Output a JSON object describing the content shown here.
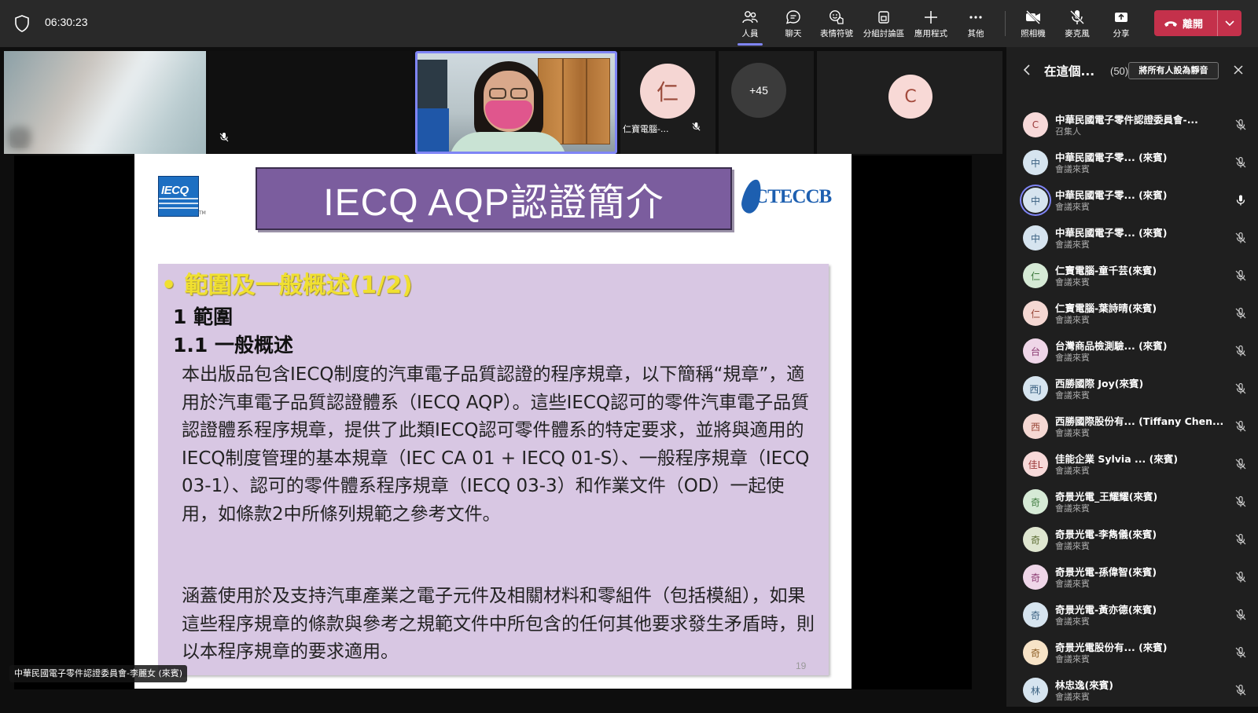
{
  "call": {
    "timer": "06:30:23",
    "toolbar": [
      {
        "label": "人員",
        "icon": "people-icon",
        "active": true
      },
      {
        "label": "聊天",
        "icon": "chat-icon"
      },
      {
        "label": "表情符號",
        "icon": "reactions-icon"
      },
      {
        "label": "分組討論區",
        "icon": "breakout-rooms-icon"
      },
      {
        "label": "應用程式",
        "icon": "add-apps-icon"
      },
      {
        "label": "其他",
        "icon": "more-icon"
      },
      {
        "label": "照相機",
        "icon": "camera-off-icon"
      },
      {
        "label": "麥克風",
        "icon": "mic-off-icon"
      },
      {
        "label": "分享",
        "icon": "share-icon"
      }
    ],
    "leave_label": "離開"
  },
  "video_strip": {
    "tile4_initial": "仁",
    "tile4_name": "仁寶電腦-...",
    "overflow_count": "+45",
    "tile6_initial": "C"
  },
  "slide": {
    "title": "IECQ AQP認證簡介",
    "left_logo": "IECQ",
    "right_logo": "CTECCB",
    "bullet": "•  範圍及一般概述(1/2)",
    "section_1": "1 範圍",
    "section_1_1": "1.1 一般概述",
    "paragraph_1": "本出版品包含IECQ制度的汽車電子品質認證的程序規章，以下簡稱“規章”，適用於汽車電子品質認證體系（IECQ AQP）。這些IECQ認可的零件汽車電子品質認證體系程序規章，提供了此類IECQ認可零件體系的特定要求，並將與適用的IECQ制度管理的基本規章（IEC CA 01 + IECQ 01-S）、一般程序規章（IECQ 03-1）、認可的零件體系程序規章（IECQ 03-3）和作業文件（OD）一起使用，如條款2中所條列規範之參考文件。",
    "paragraph_2": "涵蓋使用於及支持汽車產業之電子元件及相關材料和零組件（包括模組），如果這些程序規章的條款與參考之規範文件中所包含的任何其他要求發生矛盾時，則以本程序規章的要求適用。",
    "page_number": "19"
  },
  "speaker_label": "中華民國電子零件認證委員會-李麗女 (來賓)",
  "panel": {
    "title": "在這個...",
    "count": "(50)",
    "mute_all_label": "將所有人設為靜音",
    "participants": [
      {
        "initial": "C",
        "name": "中華民國電子零件認證委員會-...",
        "role": "召集人",
        "bg": "#f7d9d9",
        "fg": "#9a3a3a",
        "speaking": false
      },
      {
        "initial": "中",
        "name": "中華民國電子零... (來賓)",
        "role": "會議來賓",
        "bg": "#d6e4ef",
        "fg": "#3a6080",
        "speaking": false
      },
      {
        "initial": "中",
        "name": "中華民國電子零... (來賓)",
        "role": "會議來賓",
        "bg": "#d6e4ef",
        "fg": "#3a6080",
        "speaking": true
      },
      {
        "initial": "中",
        "name": "中華民國電子零... (來賓)",
        "role": "會議來賓",
        "bg": "#d6e4ef",
        "fg": "#3a6080",
        "speaking": false
      },
      {
        "initial": "仁",
        "name": "仁寶電腦-童千芸(來賓)",
        "role": "會議來賓",
        "bg": "#d6ead6",
        "fg": "#3e7a3e",
        "speaking": false
      },
      {
        "initial": "仁",
        "name": "仁寶電腦-葉詩晴(來賓)",
        "role": "會議來賓",
        "bg": "#f5d8d3",
        "fg": "#9a4a3a",
        "speaking": false
      },
      {
        "initial": "台",
        "name": "台灣商品檢測驗... (來賓)",
        "role": "會議來賓",
        "bg": "#efd6e8",
        "fg": "#8a3a70",
        "speaking": false
      },
      {
        "initial": "西J",
        "name": "西勝國際 Joy(來賓)",
        "role": "會議來賓",
        "bg": "#d6e4ef",
        "fg": "#3a6080",
        "speaking": false
      },
      {
        "initial": "西",
        "name": "西勝國際股份有... (Tiffany Chen...",
        "role": "會議來賓",
        "bg": "#f5d8d3",
        "fg": "#9a4a3a",
        "speaking": false
      },
      {
        "initial": "佳L",
        "name": "佳能企業 Sylvia ... (來賓)",
        "role": "會議來賓",
        "bg": "#f7d9d9",
        "fg": "#9a3a3a",
        "speaking": false
      },
      {
        "initial": "奇",
        "name": "奇景光電_王耀耀(來賓)",
        "role": "會議來賓",
        "bg": "#d6ead6",
        "fg": "#3e7a3e",
        "speaking": false
      },
      {
        "initial": "奇",
        "name": "奇景光電-李雋儀(來賓)",
        "role": "會議來賓",
        "bg": "#dfe6d0",
        "fg": "#5a6a30",
        "speaking": false
      },
      {
        "initial": "奇",
        "name": "奇景光電-孫偉智(來賓)",
        "role": "會議來賓",
        "bg": "#efd6e8",
        "fg": "#8a3a70",
        "speaking": false
      },
      {
        "initial": "奇",
        "name": "奇景光電-黃亦德(來賓)",
        "role": "會議來賓",
        "bg": "#d6e4ef",
        "fg": "#3a6080",
        "speaking": false
      },
      {
        "initial": "奇",
        "name": "奇景光電股份有... (來賓)",
        "role": "會議來賓",
        "bg": "#f7e3c7",
        "fg": "#8a5a20",
        "speaking": false
      },
      {
        "initial": "林",
        "name": "林忠逸(來賓)",
        "role": "會議來賓",
        "bg": "#d6e4ef",
        "fg": "#3a6080",
        "speaking": false
      }
    ]
  }
}
